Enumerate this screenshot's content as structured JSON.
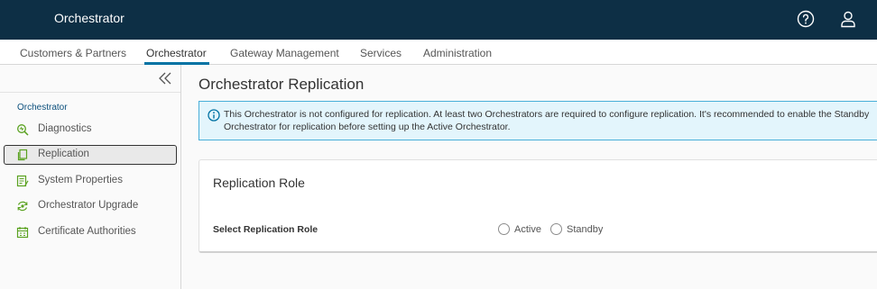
{
  "header": {
    "title": "Orchestrator"
  },
  "nav": {
    "items": [
      "Customers & Partners",
      "Orchestrator",
      "Gateway Management",
      "Services",
      "Administration"
    ],
    "active": "Orchestrator"
  },
  "sidebar": {
    "section": "Orchestrator",
    "items": [
      {
        "label": "Diagnostics",
        "icon": "diagnostics-icon"
      },
      {
        "label": "Replication",
        "icon": "replication-icon",
        "selected": true
      },
      {
        "label": "System Properties",
        "icon": "system-properties-icon"
      },
      {
        "label": "Orchestrator Upgrade",
        "icon": "upgrade-icon"
      },
      {
        "label": "Certificate Authorities",
        "icon": "certificate-icon"
      }
    ]
  },
  "main": {
    "title": "Orchestrator Replication",
    "alert": "This Orchestrator is not configured for replication. At least two Orchestrators are required to configure replication. It's recommended to enable the Standby Orchestrator for replication before setting up the Active Orchestrator.",
    "card": {
      "title": "Replication Role",
      "field_label": "Select Replication Role",
      "options": [
        "Active",
        "Standby"
      ]
    }
  },
  "colors": {
    "header_bg": "#0d2f45",
    "accent": "#0072a3",
    "alert_bg": "#e3f5fc",
    "alert_border": "#49afd9",
    "sidebar_icon": "#5aa220"
  }
}
